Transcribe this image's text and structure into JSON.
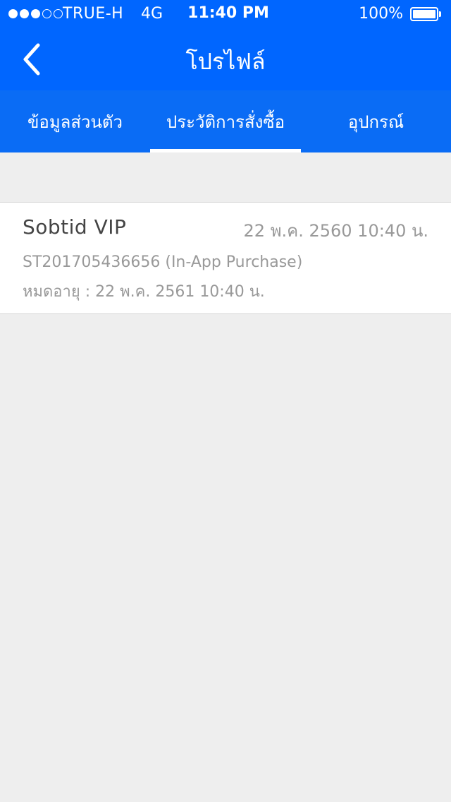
{
  "status_bar": {
    "carrier": "TRUE-H",
    "network": "4G",
    "time": "11:40 PM",
    "battery_percent": "100%",
    "signal_bars_filled": 3,
    "signal_bars_total": 5
  },
  "nav": {
    "title": "โปรไฟล์",
    "back_icon": "chevron-left-icon"
  },
  "tabs": {
    "items": [
      {
        "label": "ข้อมูลส่วนตัว"
      },
      {
        "label": "ประวัติการสั่งซื้อ"
      },
      {
        "label": "อุปกรณ์"
      }
    ],
    "selected_index": 1
  },
  "purchases": [
    {
      "title": "Sobtid VIP",
      "date": "22 พ.ค. 2560 10:40 น.",
      "order": "ST201705436656 (In-App Purchase)",
      "expire": "หมดอายุ : 22 พ.ค. 2561 10:40 น."
    }
  ],
  "colors": {
    "primary": "#0066ff",
    "background": "#eeeeee",
    "title_text": "#444444",
    "secondary_text": "#999999"
  }
}
